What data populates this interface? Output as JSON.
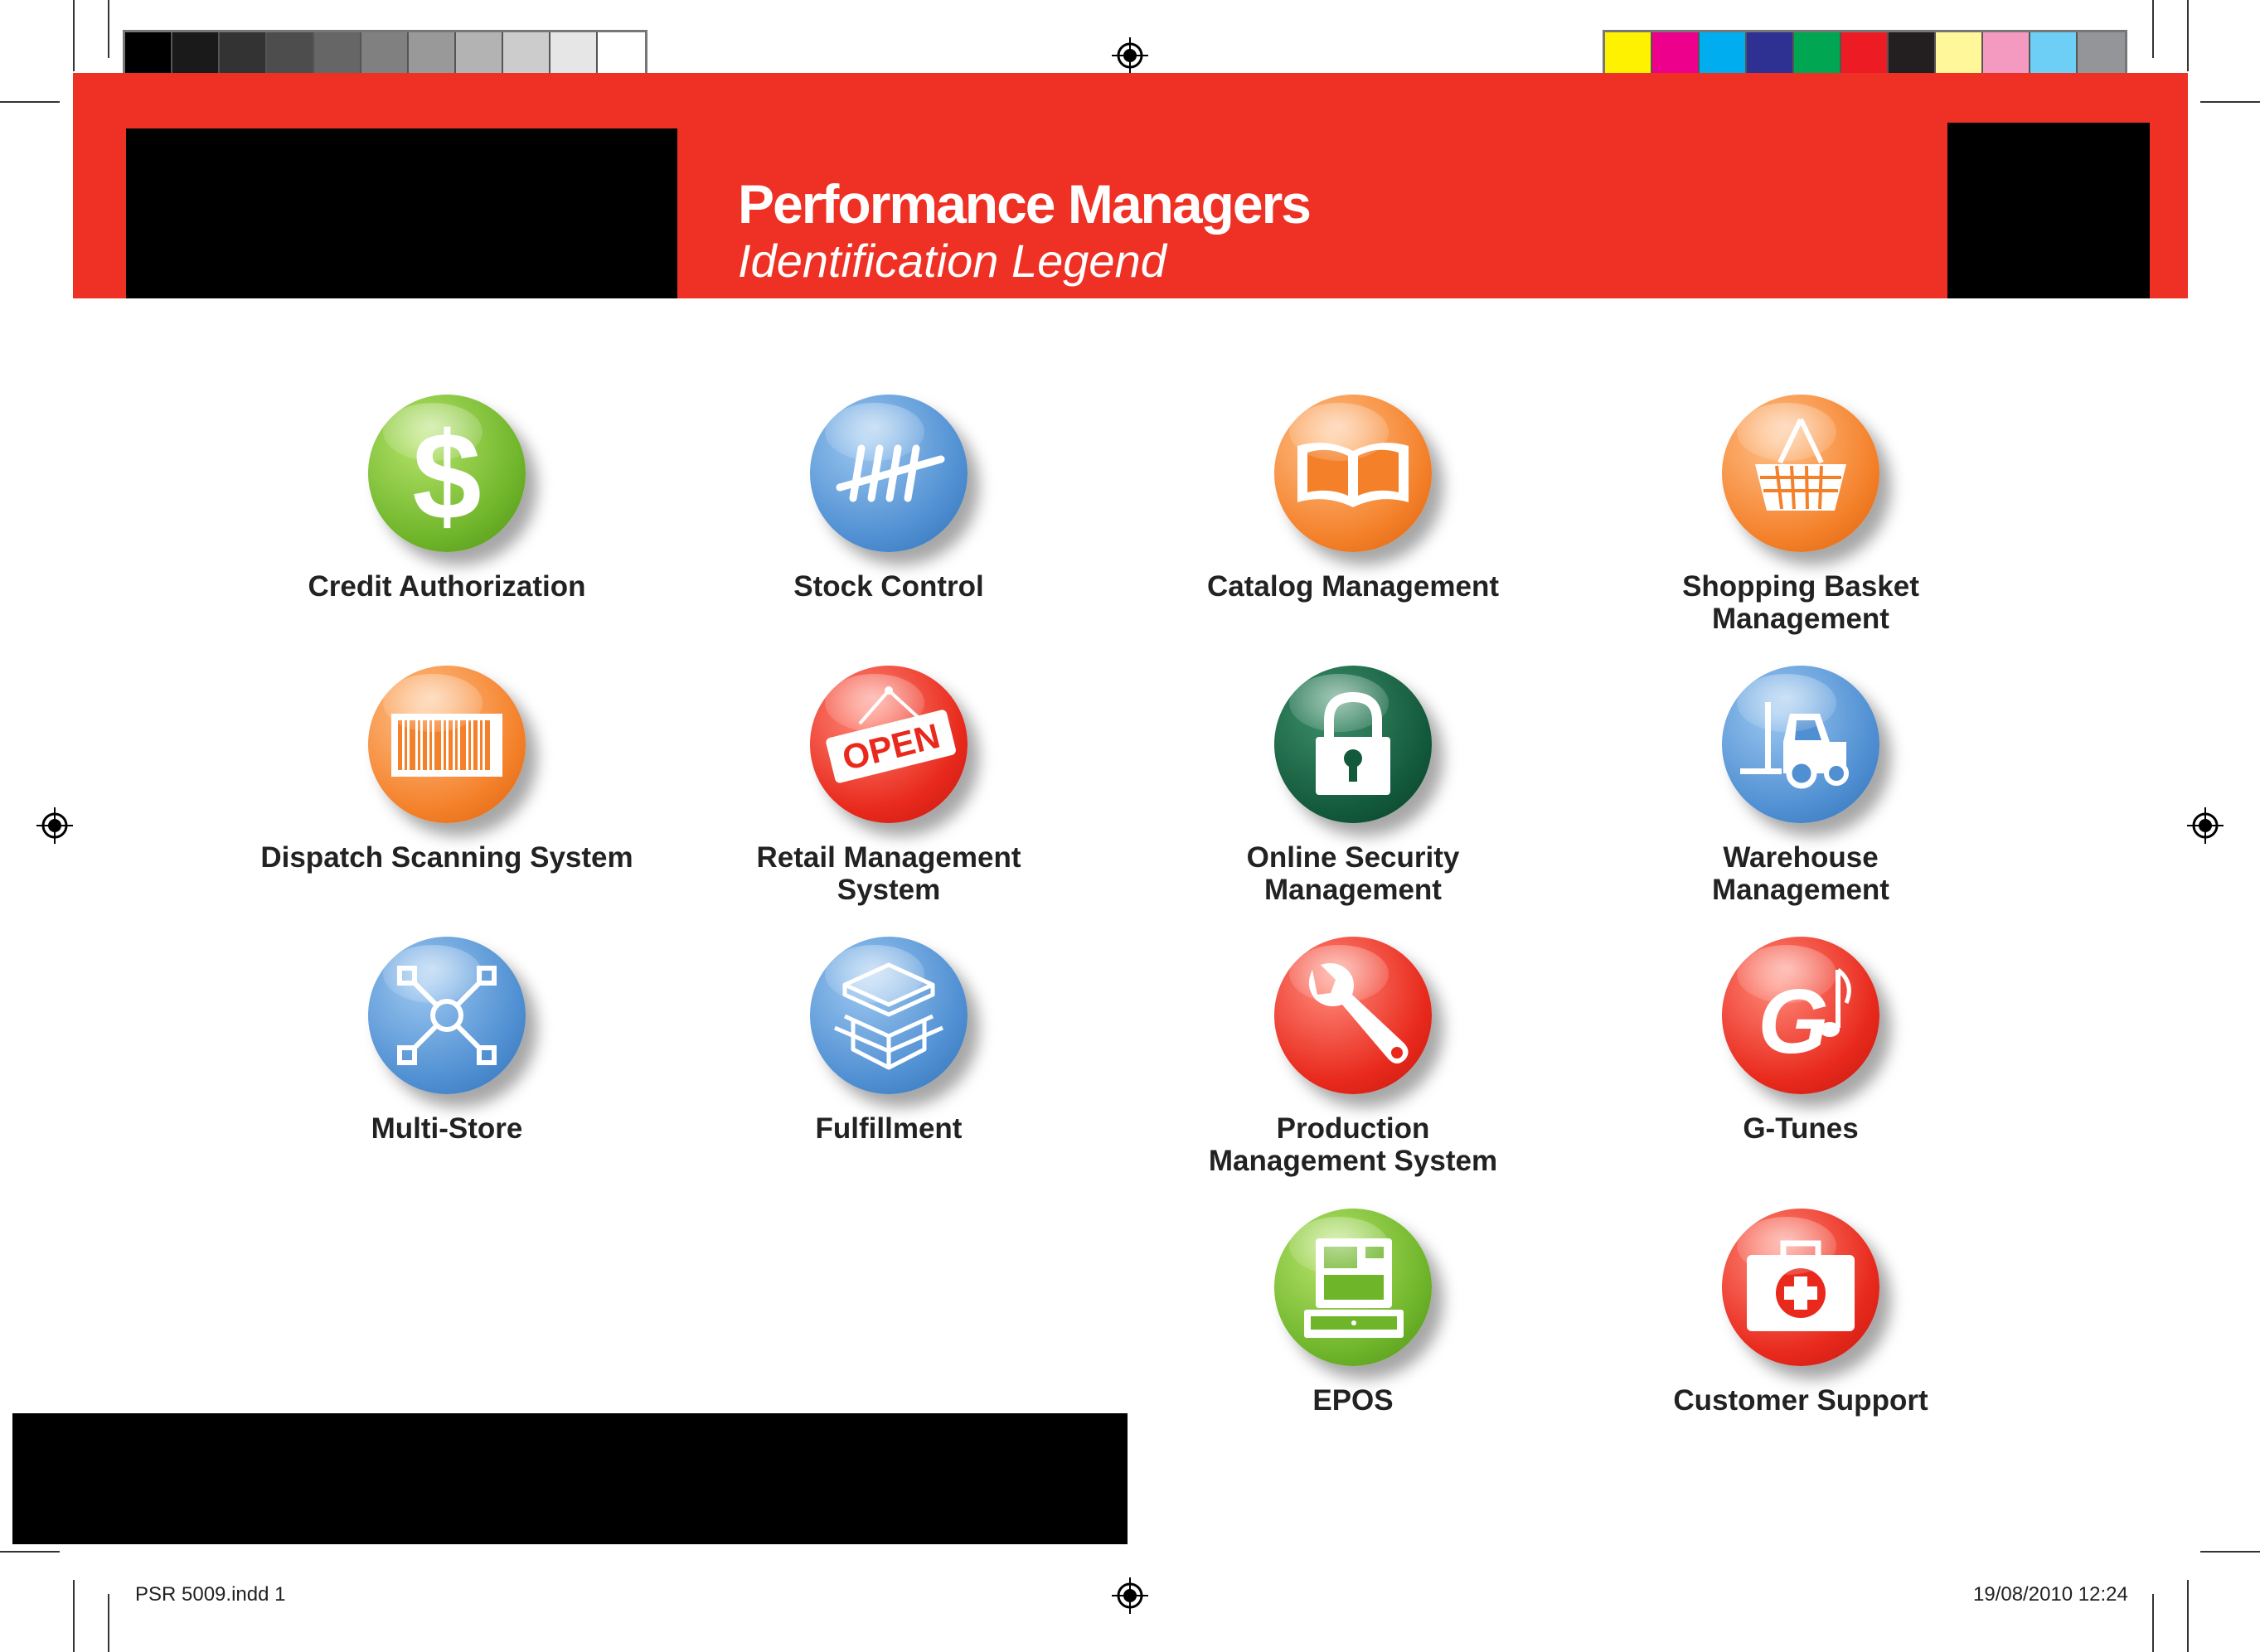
{
  "header": {
    "title": "Performance Managers",
    "subtitle": "Identification Legend"
  },
  "colors": {
    "header_red": "#ee3124",
    "grayscale_bar": [
      "#000000",
      "#1a1a1a",
      "#333333",
      "#4d4d4d",
      "#666666",
      "#808080",
      "#999999",
      "#b3b3b3",
      "#cccccc",
      "#e6e6e6",
      "#ffffff"
    ],
    "process_bar": [
      "#fff200",
      "#ec008c",
      "#00aeef",
      "#2e3192",
      "#00a651",
      "#ed1c24",
      "#231f20",
      "#fff799",
      "#f49ac1",
      "#6dcff6",
      "#939598"
    ]
  },
  "icons": [
    {
      "icon": "dollar-icon",
      "color": "green",
      "label": [
        "Credit Authorization"
      ]
    },
    {
      "icon": "tally-marks-icon",
      "color": "blue",
      "label": [
        "Stock Control"
      ]
    },
    {
      "icon": "open-book-icon",
      "color": "orange",
      "label": [
        "Catalog Management"
      ]
    },
    {
      "icon": "shopping-basket-icon",
      "color": "orange",
      "label": [
        "Shopping Basket",
        "Management"
      ]
    },
    {
      "icon": "barcode-icon",
      "color": "orange",
      "label": [
        "Dispatch Scanning System"
      ]
    },
    {
      "icon": "open-sign-icon",
      "color": "red",
      "label": [
        "Retail Management",
        "System"
      ],
      "sign_text": "OPEN"
    },
    {
      "icon": "padlock-icon",
      "color": "dark-green",
      "label": [
        "Online  Security",
        "Management"
      ]
    },
    {
      "icon": "forklift-icon",
      "color": "blue",
      "label": [
        "Warehouse",
        "Management"
      ]
    },
    {
      "icon": "network-nodes-icon",
      "color": "blue",
      "label": [
        "Multi-Store"
      ]
    },
    {
      "icon": "stacked-boxes-icon",
      "color": "blue",
      "label": [
        "Fulfillment"
      ]
    },
    {
      "icon": "wrench-icon",
      "color": "red",
      "label": [
        "Production",
        "Management System"
      ]
    },
    {
      "icon": "g-music-note-icon",
      "color": "red",
      "label": [
        "G-Tunes"
      ],
      "glyph": "G"
    },
    {
      "icon": "cash-register-icon",
      "color": "green",
      "label": [
        "EPOS"
      ]
    },
    {
      "icon": "first-aid-kit-icon",
      "color": "red",
      "label": [
        "Customer Support"
      ]
    }
  ],
  "footer": {
    "file": "PSR 5009.indd   1",
    "datetime": "19/08/2010   12:24"
  }
}
